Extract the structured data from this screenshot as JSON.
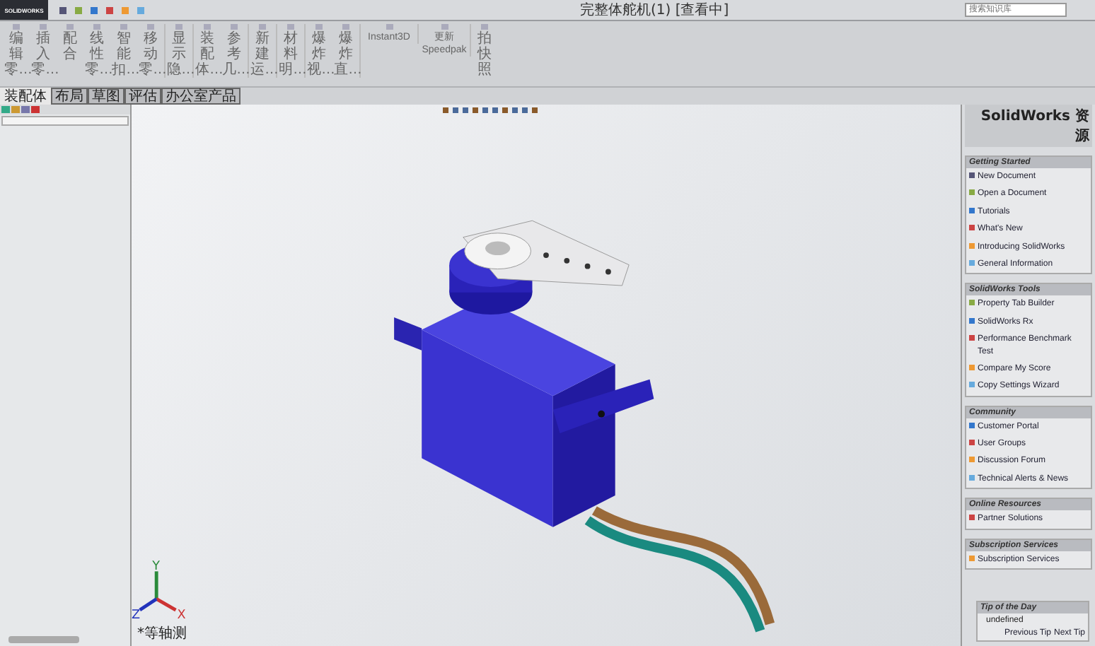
{
  "logo_text": "SOLIDWORKS",
  "window": {
    "title": "完整体舵机(1) [查看中]"
  },
  "search": {
    "placeholder": "搜索知识库"
  },
  "ribbon": [
    {
      "label": "编辑零…",
      "kind": "vertical"
    },
    {
      "label": "插入零…",
      "kind": "vertical"
    },
    {
      "label": "配合",
      "kind": "vertical"
    },
    {
      "label": "线性零…",
      "kind": "vertical"
    },
    {
      "label": "智能扣…",
      "kind": "vertical"
    },
    {
      "label": "移动零…",
      "kind": "vertical"
    },
    {
      "label": "显示隐…",
      "kind": "vertical"
    },
    {
      "label": "装配体…",
      "kind": "vertical"
    },
    {
      "label": "参考几…",
      "kind": "vertical"
    },
    {
      "label": "新建运…",
      "kind": "vertical"
    },
    {
      "label": "材料明…",
      "kind": "vertical"
    },
    {
      "label": "爆炸视…",
      "kind": "vertical"
    },
    {
      "label": "爆炸直…",
      "kind": "vertical"
    },
    {
      "label": "Instant3D",
      "kind": "horizontal"
    },
    {
      "label": "更新 Speedpak",
      "kind": "horizontal"
    },
    {
      "label": "拍快照",
      "kind": "vertical"
    }
  ],
  "tabs": [
    {
      "label": "装配体",
      "selected": true
    },
    {
      "label": "布局",
      "selected": false
    },
    {
      "label": "草图",
      "selected": false
    },
    {
      "label": "评估",
      "selected": false
    },
    {
      "label": "办公室产品",
      "selected": false
    }
  ],
  "viewport": {
    "view_label": "*等轴测",
    "axes": {
      "x": "X",
      "y": "Y",
      "z": "Z"
    }
  },
  "task_pane": {
    "title": "SolidWorks 资源",
    "sections": [
      {
        "title": "Getting Started",
        "items": [
          "New Document",
          "Open a Document",
          "Tutorials",
          "What's New",
          "Introducing SolidWorks",
          "General Information"
        ]
      },
      {
        "title": "SolidWorks Tools",
        "items": [
          "Property Tab Builder",
          "SolidWorks Rx",
          "Performance Benchmark Test",
          "Compare My Score",
          "Copy Settings Wizard"
        ]
      },
      {
        "title": "Community",
        "items": [
          "Customer Portal",
          "User Groups",
          "Discussion Forum",
          "Technical Alerts & News"
        ]
      },
      {
        "title": "Online Resources",
        "items": [
          "Partner Solutions"
        ]
      },
      {
        "title": "Subscription Services",
        "items": [
          "Subscription Services"
        ]
      }
    ]
  },
  "tip": {
    "title": "Tip of the Day",
    "text": "undefined",
    "buttons": [
      "Previous Tip",
      "Next Tip"
    ]
  }
}
